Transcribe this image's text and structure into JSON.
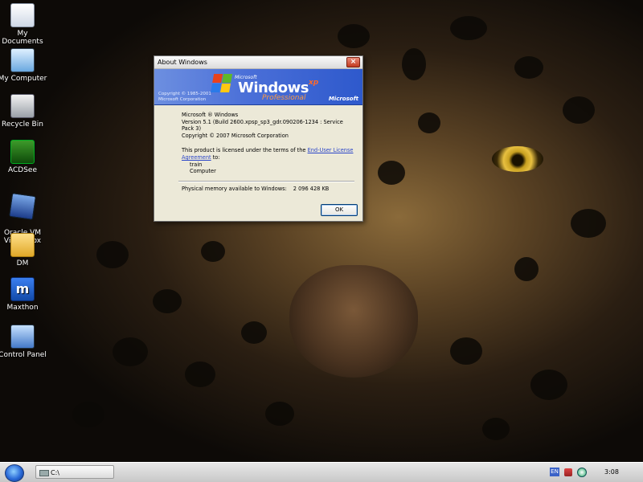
{
  "desktop": {
    "icons": [
      {
        "label": "My Documents"
      },
      {
        "label": "My Computer"
      },
      {
        "label": "Recycle Bin"
      },
      {
        "label": "ACDSee"
      },
      {
        "label": "Oracle VM\nVirtualBox"
      },
      {
        "label": "DM"
      },
      {
        "label": "Maxthon"
      },
      {
        "label": "Control Panel"
      }
    ]
  },
  "dialog": {
    "title": "About Windows",
    "banner": {
      "copyright": "Copyright © 1985-2001\nMicrosoft Corporation",
      "brand_small": "Microsoft",
      "brand_windows": "Windows",
      "brand_xp": "xp",
      "brand_edition": "Professional",
      "brand_logo": "Microsoft"
    },
    "product_name": "Microsoft ® Windows",
    "version": "Version 5.1 (Build 2600.xpsp_sp3_gdr.090206-1234 : Service Pack 3)",
    "copyright": "Copyright © 2007 Microsoft Corporation",
    "license_text": "This product is licensed under the terms of the ",
    "license_link": "End-User License Agreement",
    "license_suffix": " to:",
    "licensee_user": "train",
    "licensee_org": "Computer",
    "memory_label": "Physical memory available to Windows:",
    "memory_value": "2 096 428 KB",
    "ok_label": "OK"
  },
  "taskbar": {
    "task_label": "C:\\",
    "tray_lang": "EN",
    "clock": "3:08"
  }
}
